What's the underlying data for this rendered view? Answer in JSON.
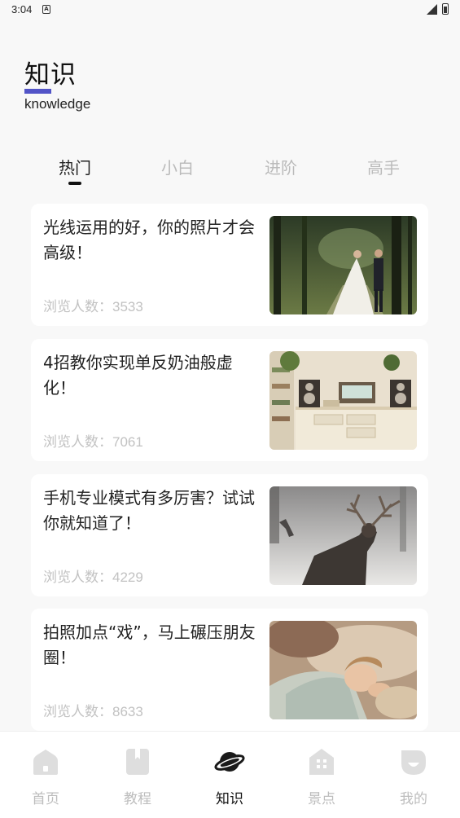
{
  "status": {
    "time": "3:04"
  },
  "header": {
    "title": "知识",
    "subtitle": "knowledge",
    "accent_color": "#5254c7"
  },
  "tabs": [
    {
      "label": "热门",
      "active": true
    },
    {
      "label": "小白",
      "active": false
    },
    {
      "label": "进阶",
      "active": false
    },
    {
      "label": "高手",
      "active": false
    }
  ],
  "articles": [
    {
      "title": "光线运用的好，你的照片才会高级！",
      "views_label": "浏览人数：",
      "views": "3533",
      "image": "wedding-couple-forest-photo"
    },
    {
      "title": "4招教你实现单反奶油般虚化！",
      "views_label": "浏览人数：",
      "views": "7061",
      "image": "cream-cabinet-speakers-photo"
    },
    {
      "title": "手机专业模式有多厉害？试试你就知道了！",
      "views_label": "浏览人数：",
      "views": "4229",
      "image": "deer-in-snow-photo"
    },
    {
      "title": "拍照加点“戏”，马上碾压朋友圈！",
      "views_label": "浏览人数：",
      "views": "8633",
      "image": "sleeping-child-photo"
    }
  ],
  "bottom_nav": [
    {
      "label": "首页",
      "icon": "home-icon",
      "active": false
    },
    {
      "label": "教程",
      "icon": "bookmark-book-icon",
      "active": false
    },
    {
      "label": "知识",
      "icon": "planet-icon",
      "active": true
    },
    {
      "label": "景点",
      "icon": "building-icon",
      "active": false
    },
    {
      "label": "我的",
      "icon": "profile-face-icon",
      "active": false
    }
  ]
}
